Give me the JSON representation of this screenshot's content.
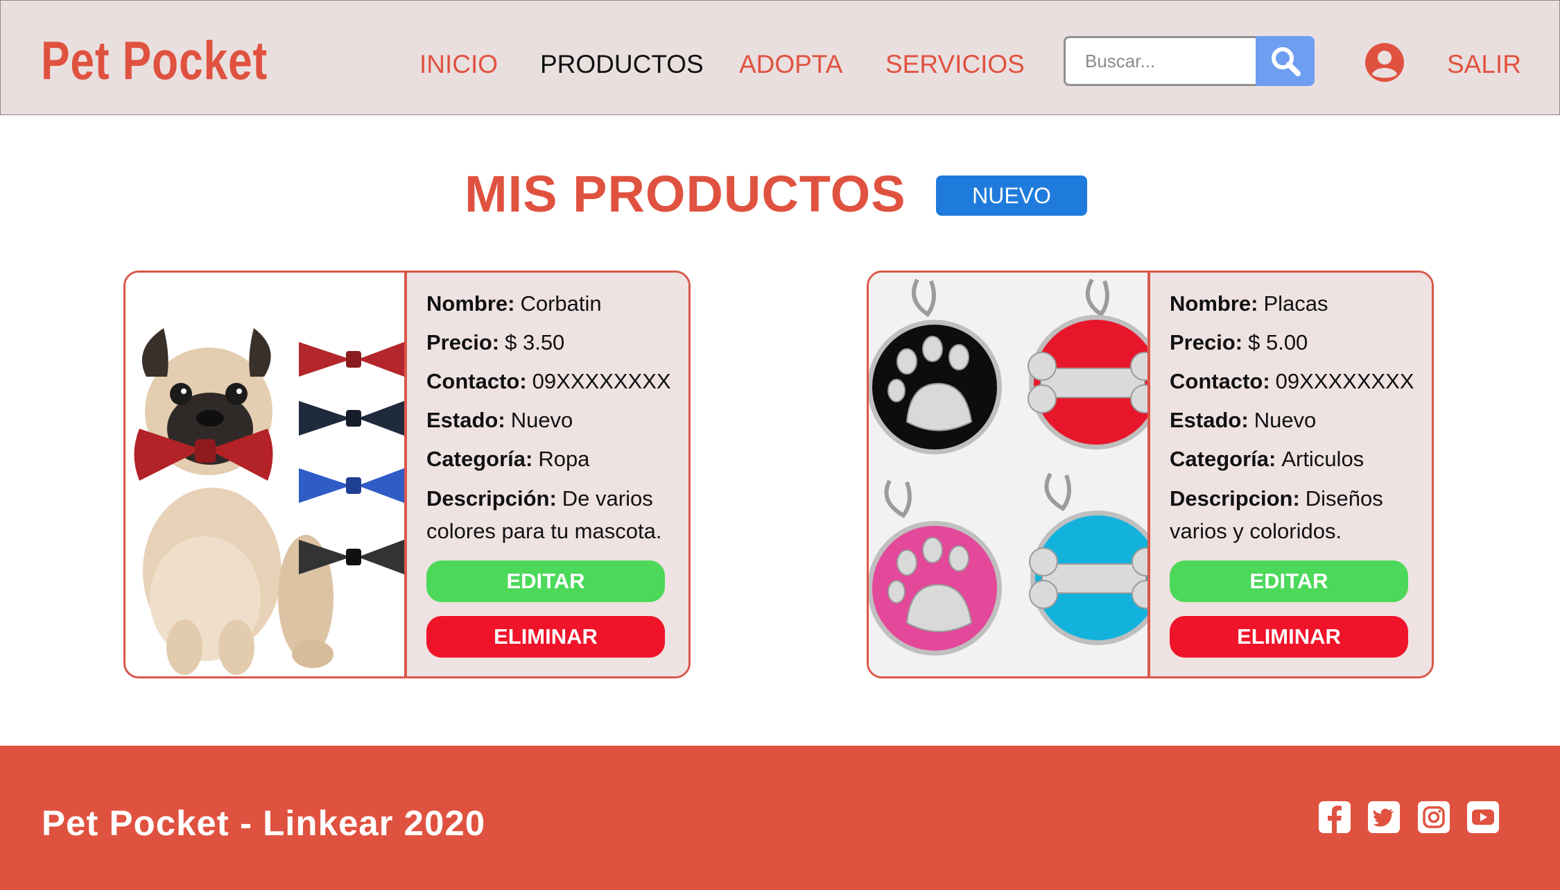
{
  "header": {
    "logo": "Pet Pocket",
    "nav": [
      "INICIO",
      "PRODUCTOS",
      "ADOPTA",
      "SERVICIOS"
    ],
    "active_nav": "PRODUCTOS",
    "search": {
      "placeholder": "Buscar..."
    },
    "logout": "SALIR"
  },
  "main": {
    "title": "MIS PRODUCTOS",
    "new_button": "NUEVO",
    "products": [
      {
        "name_label": "Nombre:",
        "name": "Corbatin",
        "price_label": "Precio:",
        "price": "$ 3.50",
        "contact_label": "Contacto:",
        "contact": "09XXXXXXXX",
        "state_label": "Estado:",
        "state": "Nuevo",
        "category_label": "Categoría:",
        "category": "Ropa",
        "description_label": "Descripción:",
        "description": "De varios colores para tu mascota.",
        "edit": "EDITAR",
        "delete": "ELIMINAR",
        "image": "pug-with-bow-ties"
      },
      {
        "name_label": "Nombre:",
        "name": "Placas",
        "price_label": "Precio:",
        "price": "$ 5.00",
        "contact_label": "Contacto:",
        "contact": "09XXXXXXXX",
        "state_label": "Estado:",
        "state": "Nuevo",
        "category_label": "Categoría:",
        "category": "Articulos",
        "description_label": "Descripcion:",
        "description": "Diseños varios y coloridos.",
        "edit": "EDITAR",
        "delete": "ELIMINAR",
        "image": "pet-id-tags"
      }
    ]
  },
  "footer": {
    "text": "Pet Pocket - Linkear 2020",
    "social": [
      "facebook-icon",
      "twitter-icon",
      "instagram-icon",
      "youtube-icon"
    ]
  },
  "colors": {
    "brand": "#e05240",
    "header_bg": "#eadfdf",
    "card_bg": "#efe2e2",
    "new_button": "#1f7bdb",
    "search_button": "#6d9ef0",
    "edit_button": "#4cd95a",
    "delete_button": "#ef1429"
  }
}
